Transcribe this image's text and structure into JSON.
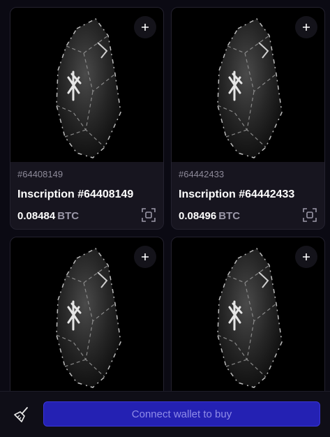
{
  "cards": [
    {
      "number": "#64408149",
      "name": "Inscription #64408149",
      "price": "0.08484",
      "currency": "BTC"
    },
    {
      "number": "#64442433",
      "name": "Inscription #64442433",
      "price": "0.08496",
      "currency": "BTC"
    },
    {
      "number": "",
      "name": "",
      "price": "",
      "currency": ""
    },
    {
      "number": "",
      "name": "",
      "price": "",
      "currency": ""
    }
  ],
  "bottom_bar": {
    "connect_label": "Connect wallet to buy",
    "sweep_icon": "broom-icon"
  },
  "icons": {
    "add": "plus-icon",
    "preview": "scan-icon"
  },
  "colors": {
    "background": "#0b0a13",
    "card": "#17151f",
    "accent": "#2421b3",
    "muted": "#8d8a99"
  }
}
